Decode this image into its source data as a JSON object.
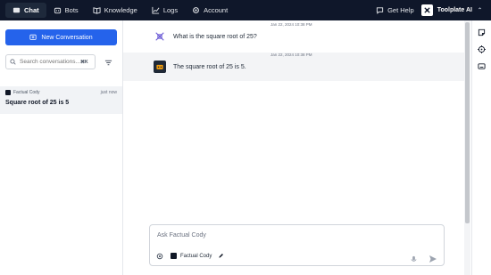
{
  "nav": {
    "items": [
      {
        "label": "Chat",
        "icon": "chat-icon",
        "active": true
      },
      {
        "label": "Bots",
        "icon": "bot-icon"
      },
      {
        "label": "Knowledge",
        "icon": "book-icon"
      },
      {
        "label": "Logs",
        "icon": "chart-icon"
      },
      {
        "label": "Account",
        "icon": "gear-icon"
      }
    ],
    "help_label": "Get Help",
    "workspace_label": "Toolplate AI"
  },
  "sidebar": {
    "new_conversation_label": "New Conversation",
    "search_placeholder": "Search conversations...",
    "search_shortcut": "⌘K",
    "conversations": [
      {
        "bot_name": "Factual Cody",
        "time": "just now",
        "title": "Square root of 25 is 5"
      }
    ]
  },
  "chat": {
    "messages": [
      {
        "role": "user",
        "timestamp": "Jan 22, 2024 10:38 PM",
        "text": "What is the square root of 25?"
      },
      {
        "role": "bot",
        "timestamp": "Jan 22, 2024 10:38 PM",
        "text": "The square root of 25 is 5."
      }
    ],
    "input_placeholder": "Ask Factual Cody",
    "selected_bot": "Factual Cody"
  },
  "colors": {
    "topbar": "#0f172a",
    "accent": "#2563eb",
    "selected_row": "#f1f3f6"
  }
}
